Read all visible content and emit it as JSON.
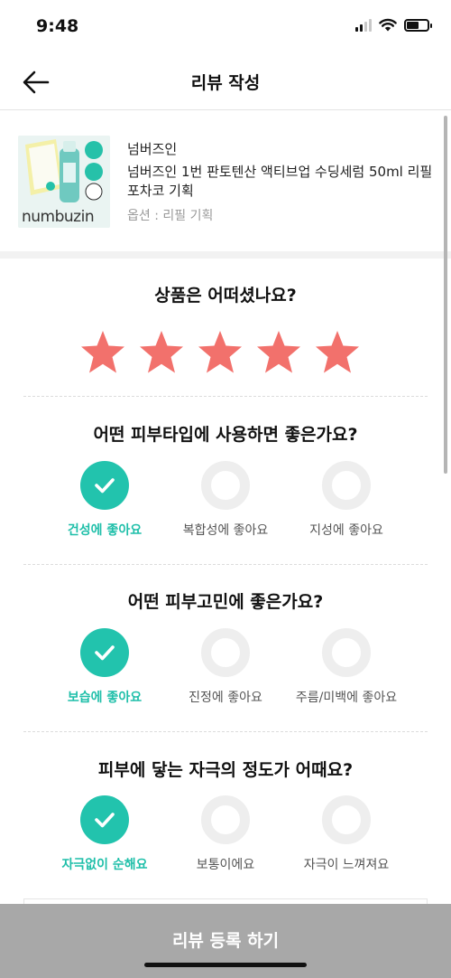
{
  "status_bar": {
    "time": "9:48"
  },
  "header": {
    "title": "리뷰 작성"
  },
  "product": {
    "thumb_brand": "numbuzin",
    "brand": "넘버즈인",
    "name": "넘버즈인 1번 판토텐산 액티브업 수딩세럼 50ml 리필 포차코 기획",
    "option": "옵션 : 리필 기획"
  },
  "rating": {
    "question": "상품은 어떠셨나요?",
    "value": 5,
    "max": 5,
    "star_color": "#f2716c"
  },
  "questions": [
    {
      "title": "어떤 피부타입에 사용하면 좋은가요?",
      "options": [
        {
          "label": "건성에 좋아요",
          "selected": true
        },
        {
          "label": "복합성에 좋아요",
          "selected": false
        },
        {
          "label": "지성에 좋아요",
          "selected": false
        }
      ]
    },
    {
      "title": "어떤 피부고민에 좋은가요?",
      "options": [
        {
          "label": "보습에 좋아요",
          "selected": true
        },
        {
          "label": "진정에 좋아요",
          "selected": false
        },
        {
          "label": "주름/미백에 좋아요",
          "selected": false
        }
      ]
    },
    {
      "title": "피부에 닿는 자극의 정도가 어때요?",
      "options": [
        {
          "label": "자극없이 순해요",
          "selected": true
        },
        {
          "label": "보통이에요",
          "selected": false
        },
        {
          "label": "자극이 느껴져요",
          "selected": false
        }
      ]
    }
  ],
  "submit": {
    "label": "리뷰 등록 하기"
  },
  "colors": {
    "accent": "#22c3ad",
    "submit_bg": "#a8a8a8"
  }
}
